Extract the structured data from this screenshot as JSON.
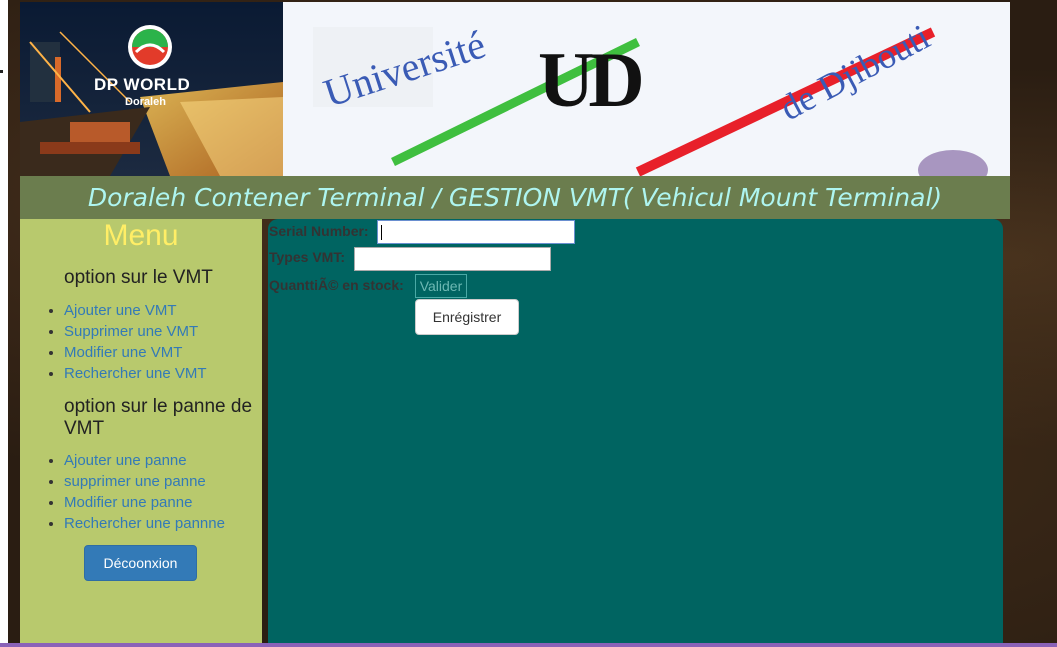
{
  "banner": {
    "left_logo_title": "DP WORLD",
    "left_logo_subtitle": "Doraleh",
    "right_logo_word1": "Université",
    "right_logo_word2": "de Djibouti",
    "right_logo_monogram": "UD"
  },
  "header": {
    "title": "Doraleh Contener Terminal / GESTION VMT( Vehicul Mount Terminal)"
  },
  "sidebar": {
    "menu_title": "Menu",
    "section1_title": "option sur le VMT",
    "section1_items": [
      "Ajouter une VMT",
      "Supprimer une VMT",
      "Modifier une VMT",
      "Rechercher une VMT"
    ],
    "section2_title": "option sur le panne de VMT",
    "section2_items": [
      "Ajouter une panne",
      "supprimer une panne",
      "Modifier une panne",
      "Rechercher une pannne"
    ],
    "logout_label": "Décoonxion"
  },
  "form": {
    "serial_label": "Serial Number:",
    "serial_value": "",
    "types_label": "Types VMT:",
    "types_value": "",
    "quantity_label": "QuanttiÃ© en stock:",
    "quantity_button": "Valider",
    "submit_label": "Enrégistrer"
  },
  "colors": {
    "title_bar": "#6b7d4e",
    "title_text": "#aef5f0",
    "sidebar": "#b8c96d",
    "main_panel": "#006461",
    "menu_title": "#ffee66",
    "link": "#337ab7",
    "primary_button": "#337ab7"
  }
}
